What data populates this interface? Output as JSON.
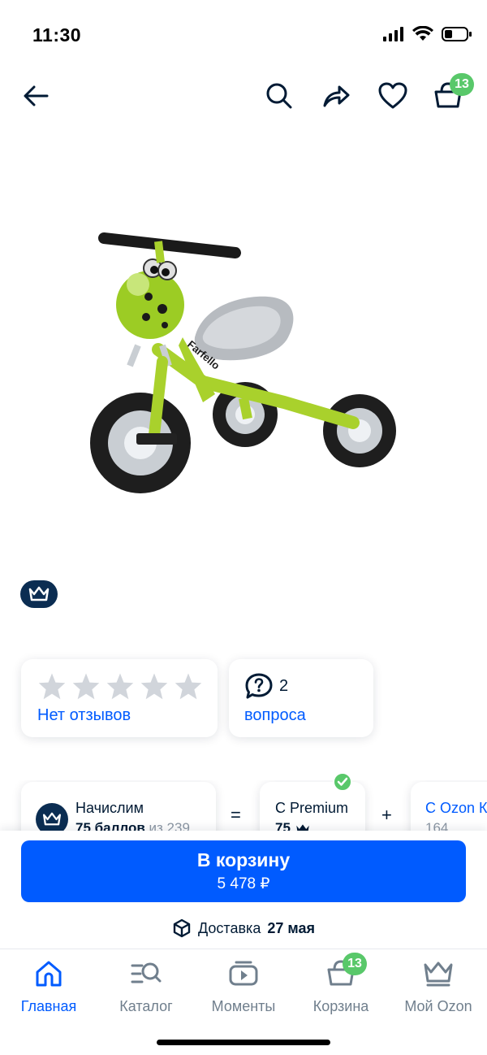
{
  "status_bar": {
    "time": "11:30"
  },
  "top_bar": {
    "icons": [
      "back-arrow-icon",
      "search-icon",
      "share-icon",
      "heart-icon",
      "cart-icon"
    ],
    "cart_count": "13"
  },
  "product": {
    "image_subject": "green tricycle",
    "brand_on_frame": "Farfello"
  },
  "reviews": {
    "rating_stars": 0,
    "label": "Нет отзывов"
  },
  "questions": {
    "count": "2",
    "label": "вопроса"
  },
  "points": {
    "card1_title": "Начислим",
    "card1_points": "75 баллов",
    "card1_of": "из 239",
    "equals": "=",
    "card2_title": "С Premium",
    "card2_value": "75",
    "plus": "+",
    "card3_title": "С Ozon Карт",
    "card3_value": "164"
  },
  "cart_button": {
    "label": "В корзину",
    "price": "5 478 ₽"
  },
  "delivery": {
    "label": "Доставка",
    "date": "27 мая"
  },
  "tab_bar": {
    "items": [
      {
        "label": "Главная",
        "icon": "home-icon",
        "active": true
      },
      {
        "label": "Каталог",
        "icon": "catalog-icon",
        "active": false
      },
      {
        "label": "Моменты",
        "icon": "play-icon",
        "active": false
      },
      {
        "label": "Корзина",
        "icon": "cart-icon",
        "active": false
      },
      {
        "label": "Мой Ozon",
        "icon": "crown-icon",
        "active": false
      }
    ],
    "cart_badge": "13"
  },
  "colors": {
    "accent_blue": "#005bff",
    "badge_green": "#59c86a",
    "navy": "#0b2d52",
    "text_dark": "#001a34",
    "text_muted": "#707f8d"
  }
}
